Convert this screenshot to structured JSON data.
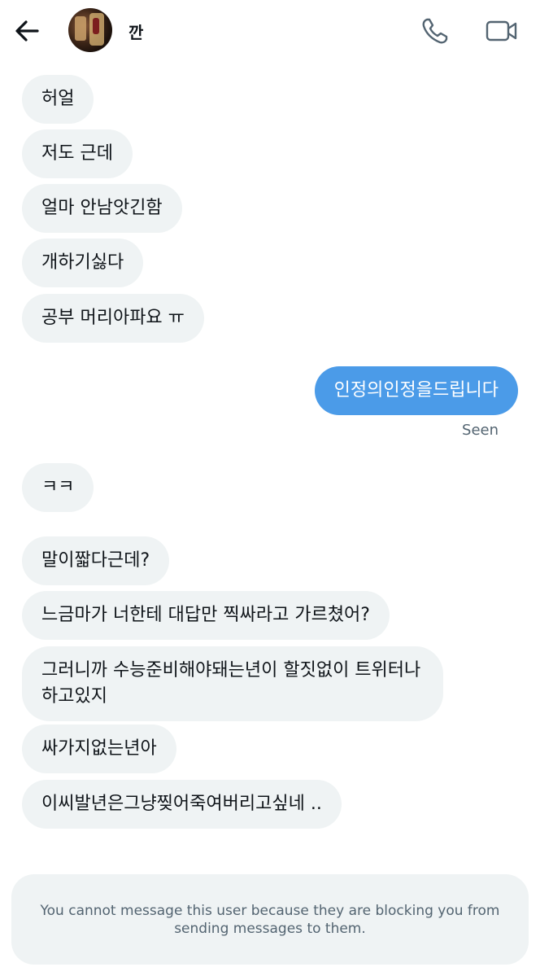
{
  "header": {
    "username": "깐",
    "icons": {
      "back": "back-arrow-icon",
      "call": "phone-icon",
      "video": "video-camera-icon"
    }
  },
  "messages": [
    {
      "side": "incoming",
      "text": "허얼"
    },
    {
      "side": "incoming",
      "text": "저도 근데"
    },
    {
      "side": "incoming",
      "text": "얼마 안남앗긴함"
    },
    {
      "side": "incoming",
      "text": "개하기싫다"
    },
    {
      "side": "incoming",
      "text": "공부 머리아파요 ㅠ"
    },
    {
      "side": "outgoing",
      "text": "인정의인정을드립니다"
    },
    {
      "side": "incoming",
      "text": "ㅋㅋ"
    },
    {
      "side": "incoming",
      "text": "말이짧다근데?"
    },
    {
      "side": "incoming",
      "text": "느금마가 너한테 대답만 찍싸라고 가르쳤어?"
    },
    {
      "side": "incoming",
      "text": "그러니까 수능준비해야돼는년이 할짓없이 트위터나 하고있지"
    },
    {
      "side": "incoming",
      "text": "싸가지없는년아"
    },
    {
      "side": "incoming",
      "text": "이씨발년은그냥찢어죽여버리고싶네 .."
    }
  ],
  "status": {
    "seen_label": "Seen"
  },
  "notice": {
    "text": "You cannot message this user because they are blocking you from sending messages to them."
  },
  "colors": {
    "incoming_bubble": "#eff3f4",
    "outgoing_bubble": "#4b9be8",
    "muted_text": "#536471"
  }
}
